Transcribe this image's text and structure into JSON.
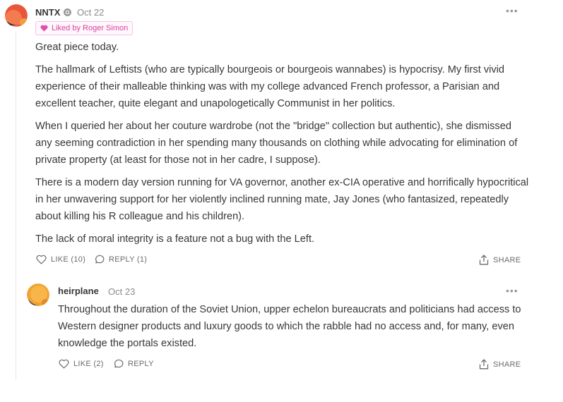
{
  "comments": [
    {
      "author": "NNTX",
      "date": "Oct 22",
      "liked_by": "Liked by Roger Simon",
      "paragraphs": [
        "Great piece today.",
        "The hallmark of Leftists (who are typically bourgeois or bourgeois wannabes) is hypocrisy. My first vivid experience of their malleable thinking was with my college advanced French professor, a Parisian and excellent teacher, quite elegant and unapologetically Communist in her politics.",
        "When I queried her about her couture wardrobe (not the \"bridge\" collection but authentic), she dismissed any seeming contradiction in her spending many thousands on clothing while advocating for elimination of private property (at least for those not in her cadre, I suppose).",
        "There is a modern day version running for VA governor, another ex-CIA operative and horrifically hypocritical in her unwavering support for her violently inclined running mate, Jay Jones (who fantasized, repeatedly about killing his R colleague and his children).",
        "The lack of moral integrity is a feature not a bug with the Left."
      ],
      "like_label": "LIKE (10)",
      "reply_label": "REPLY (1)",
      "share_label": "SHARE"
    },
    {
      "author": "heirplane",
      "date": "Oct 23",
      "paragraphs": [
        "Throughout the duration of the Soviet Union, upper echelon bureaucrats and politicians had access to Western designer products and luxury goods to which the rabble had no access and, for many, even knowledge the portals existed."
      ],
      "like_label": "LIKE (2)",
      "reply_label": "REPLY",
      "share_label": "SHARE"
    }
  ],
  "icons": {
    "more": "more-icon",
    "heart": "heart-icon",
    "like": "heart-outline-icon",
    "reply": "speech-bubble-icon",
    "share": "share-icon",
    "badge": "subscriber-badge-icon"
  },
  "colors": {
    "liked_accent": "#d93fa0",
    "text": "#363737",
    "muted": "#8a8a8a"
  }
}
